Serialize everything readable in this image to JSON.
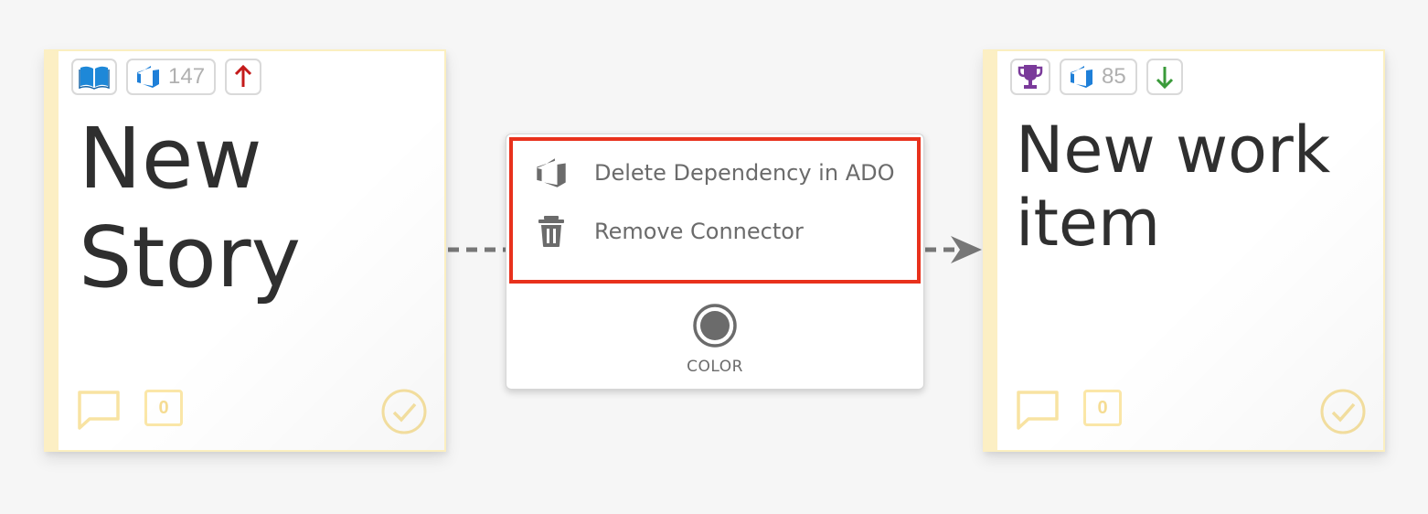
{
  "colors": {
    "background": "#f6f6f6",
    "note_border": "#fcefc4",
    "highlight": "#e8311c",
    "menu_text": "#6b6b6b",
    "priority_up": "#c41a1a",
    "priority_down": "#3a9a3a",
    "ado_blue": "#1e7fd8",
    "story_icon_blue": "#1e88d8",
    "trophy_purple": "#7a3a9a"
  },
  "left_note": {
    "title": "New\nStory",
    "type_icon": "book-icon",
    "ado_id": "147",
    "priority_icon": "arrow-up-icon",
    "comment_count": "0"
  },
  "right_note": {
    "title": "New work\nitem",
    "type_icon": "trophy-icon",
    "ado_id": "85",
    "priority_icon": "arrow-down-icon",
    "comment_count": "0"
  },
  "context_menu": {
    "items": [
      {
        "label": "Delete Dependency in ADO",
        "icon": "azure-devops-icon"
      },
      {
        "label": "Remove Connector",
        "icon": "trash-icon"
      }
    ],
    "color_label": "COLOR"
  }
}
